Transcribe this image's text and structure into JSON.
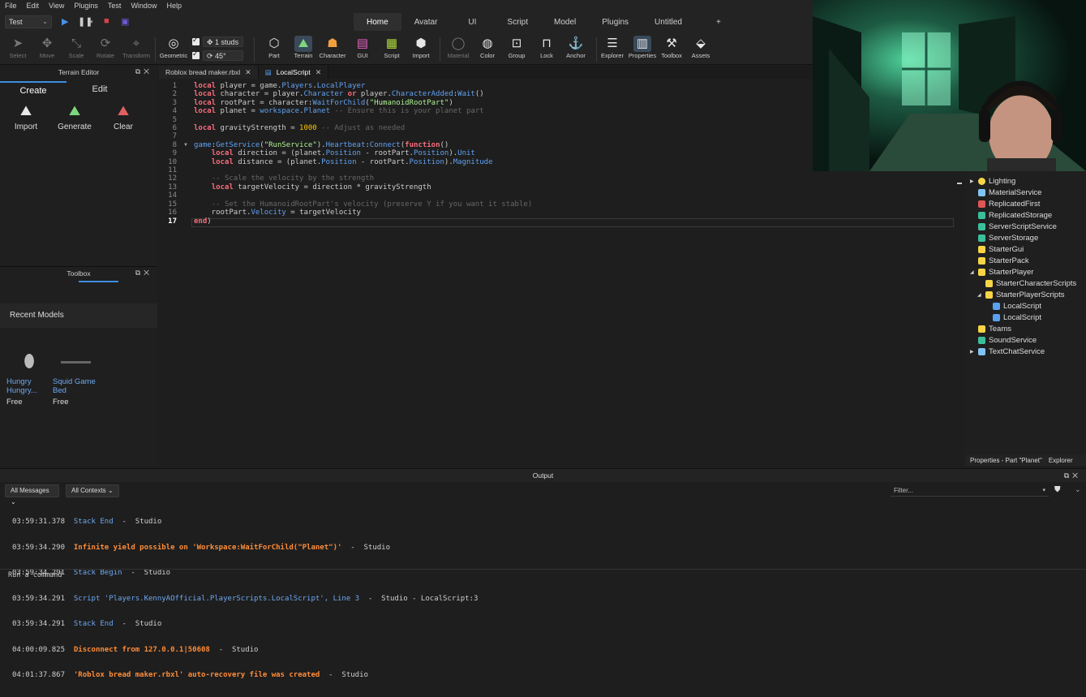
{
  "menu": [
    "File",
    "Edit",
    "View",
    "Plugins",
    "Test",
    "Window",
    "Help"
  ],
  "mode_select": "Test",
  "ribbon_tabs": [
    "Home",
    "Avatar",
    "UI",
    "Script",
    "Model",
    "Plugins",
    "Untitled",
    "+"
  ],
  "ribbon_tools": {
    "select": "Select",
    "move": "Move",
    "scale": "Scale",
    "rotate": "Rotate",
    "transform": "Transform",
    "geometric": "Geometric",
    "snap_move": "1 studs",
    "snap_rotate": "45°",
    "part": "Part",
    "terrain": "Terrain",
    "character": "Character",
    "gui": "GUI",
    "script": "Script",
    "import": "Import",
    "material": "Material",
    "color": "Color",
    "group": "Group",
    "lock": "Lock",
    "anchor": "Anchor",
    "explorer": "Explorer",
    "properties": "Properties",
    "toolbox": "Toolbox",
    "assets": "Assets"
  },
  "terrain_editor": {
    "title": "Terrain Editor",
    "tabs": [
      "Create",
      "Edit"
    ],
    "tools": [
      "Import",
      "Generate",
      "Clear"
    ]
  },
  "toolbox": {
    "title": "Toolbox",
    "section": "Recent Models",
    "models": [
      {
        "name1": "Hungry",
        "name2": "Hungry...",
        "price": "Free"
      },
      {
        "name1": "Squid Game",
        "name2": "Bed",
        "price": "Free"
      }
    ]
  },
  "editor_tabs": [
    "Roblox bread maker.rbxl",
    "LocalScript"
  ],
  "code_lines": [
    "1",
    "2",
    "3",
    "4",
    "5",
    "6",
    "7",
    "8",
    "9",
    "10",
    "11",
    "12",
    "13",
    "14",
    "15",
    "16",
    "17"
  ],
  "code": {
    "l1": [
      "local",
      " player = game.",
      "Players",
      ".",
      "LocalPlayer"
    ],
    "l2": [
      "local",
      " character = player.",
      "Character",
      " ",
      "or",
      " player.",
      "CharacterAdded",
      ":",
      "Wait",
      "()"
    ],
    "l3": [
      "local",
      " rootPart = character:",
      "WaitForChild",
      "(",
      "\"HumanoidRootPart\"",
      ")"
    ],
    "l4": [
      "local",
      " planet = ",
      "workspace",
      ".",
      "Planet",
      " ",
      "-- Ensure this is your planet part"
    ],
    "l6": [
      "local",
      " gravityStrength = ",
      "1000",
      " ",
      "-- Adjust as needed"
    ],
    "l8": [
      "game",
      ":",
      "GetService",
      "(",
      "\"RunService\"",
      ").",
      "Heartbeat",
      ":",
      "Connect",
      "(",
      "function",
      "()"
    ],
    "l9": [
      "    ",
      "local",
      " direction = (planet.",
      "Position",
      " - rootPart.",
      "Position",
      ").",
      "Unit"
    ],
    "l10": [
      "    ",
      "local",
      " distance = (planet.",
      "Position",
      " - rootPart.",
      "Position",
      ").",
      "Magnitude"
    ],
    "l12": [
      "    ",
      "-- Scale the velocity by the strength"
    ],
    "l13": [
      "    ",
      "local",
      " targetVelocity = direction * gravityStrength"
    ],
    "l15": [
      "    ",
      "-- Set the HumanoidRootPart's velocity (preserve Y if you want it stable)"
    ],
    "l16": [
      "    rootPart.",
      "Velocity",
      " = targetVelocity"
    ],
    "l17": [
      "end",
      ")"
    ]
  },
  "explorer_items": [
    {
      "label": "Lighting",
      "color": "#f5d547"
    },
    {
      "label": "MaterialService",
      "color": "#7fc4f5"
    },
    {
      "label": "ReplicatedFirst",
      "color": "#e05555"
    },
    {
      "label": "ReplicatedStorage",
      "color": "#3bbf9b"
    },
    {
      "label": "ServerScriptService",
      "color": "#3bbf9b"
    },
    {
      "label": "ServerStorage",
      "color": "#3bbf9b"
    },
    {
      "label": "StarterGui",
      "color": "#f5d547"
    },
    {
      "label": "StarterPack",
      "color": "#f5d547"
    },
    {
      "label": "StarterPlayer",
      "color": "#f5d547"
    },
    {
      "label": "StarterCharacterScripts",
      "color": "#f5d547"
    },
    {
      "label": "StarterPlayerScripts",
      "color": "#f5d547"
    },
    {
      "label": "LocalScript",
      "color": "#5aa0f0"
    },
    {
      "label": "LocalScript",
      "color": "#5aa0f0"
    },
    {
      "label": "Teams",
      "color": "#f5d547"
    },
    {
      "label": "SoundService",
      "color": "#3bbf9b"
    },
    {
      "label": "TextChatService",
      "color": "#7fc4f5"
    }
  ],
  "explorer_tabs": [
    "Properties - Part \"Planet\"",
    "Explorer"
  ],
  "output": {
    "title": "Output",
    "filter_messages": "All Messages",
    "filter_contexts": "All Contexts",
    "filter_placeholder": "Filter...",
    "lines": [
      {
        "ts": "03:59:31.378",
        "msg": "Stack End",
        "src": "  -  Studio",
        "kind": "blue"
      },
      {
        "ts": "03:59:34.290",
        "msg": "Infinite yield possible on 'Workspace:WaitForChild(\"Planet\")'",
        "src": "  -  Studio",
        "kind": "warn"
      },
      {
        "ts": "03:59:34.291",
        "msg": "Stack Begin",
        "src": "  -  Studio",
        "kind": "blue"
      },
      {
        "ts": "03:59:34.291",
        "msg": "Script 'Players.KennyAOfficial.PlayerScripts.LocalScript', Line 3",
        "src": "  -  Studio - LocalScript:3",
        "kind": "blue"
      },
      {
        "ts": "03:59:34.291",
        "msg": "Stack End",
        "src": "  -  Studio",
        "kind": "blue"
      },
      {
        "ts": "04:00:09.825",
        "msg": "Disconnect from 127.0.0.1|50608",
        "src": "  -  Studio",
        "kind": "warn"
      },
      {
        "ts": "04:01:37.867",
        "msg": "'Roblox bread maker.rbxl' auto-recovery file was created",
        "src": "  -  Studio",
        "kind": "warn"
      }
    ],
    "command_placeholder": "Run a command"
  }
}
